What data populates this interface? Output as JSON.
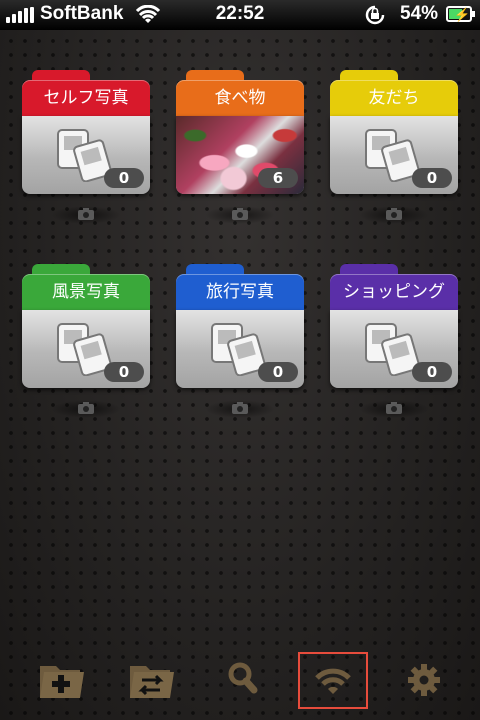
{
  "status_bar": {
    "carrier": "SoftBank",
    "time": "22:52",
    "battery": "54%"
  },
  "folders": [
    {
      "name": "セルフ写真",
      "count": "0",
      "color": "#d8192b",
      "photo": false
    },
    {
      "name": "食べ物",
      "count": "6",
      "color": "#e86d1a",
      "photo": true
    },
    {
      "name": "友だち",
      "count": "0",
      "color": "#e6cc0a",
      "photo": false
    },
    {
      "name": "風景写真",
      "count": "0",
      "color": "#3aa83a",
      "photo": false
    },
    {
      "name": "旅行写真",
      "count": "0",
      "color": "#1f5ed0",
      "photo": false
    },
    {
      "name": "ショッピング",
      "count": "0",
      "color": "#5a2fa8",
      "photo": false
    }
  ],
  "toolbar": {
    "items": [
      "add-folder-icon",
      "move-folder-icon",
      "search-icon",
      "wifi-icon",
      "settings-icon"
    ],
    "icon_color": "#6e5b3e",
    "selected": "wifi-icon"
  }
}
